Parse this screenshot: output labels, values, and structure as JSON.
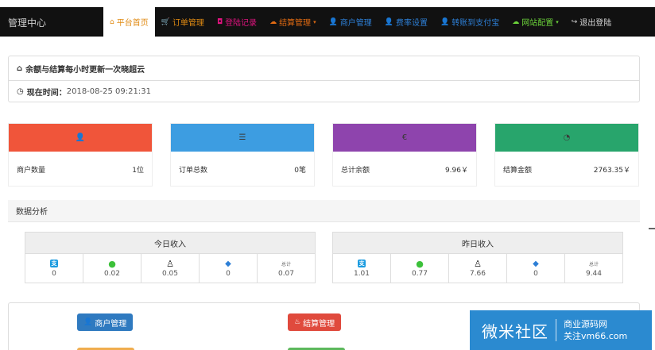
{
  "header": {
    "brand": "管理中心",
    "nav": [
      {
        "label": "平台首页",
        "icon": "⌂",
        "color": "#e08a12",
        "active": true
      },
      {
        "label": "订单管理",
        "icon": "🛒",
        "color": "#e08a12"
      },
      {
        "label": "登陆记录",
        "icon": "◘",
        "color": "#e0137f"
      },
      {
        "label": "结算管理",
        "icon": "☁",
        "color": "#e06a12",
        "caret": "▾"
      },
      {
        "label": "商户管理",
        "icon": "👤",
        "color": "#2d7fd6"
      },
      {
        "label": "费率设置",
        "icon": "👤",
        "color": "#2d7fd6"
      },
      {
        "label": "转账到支付宝",
        "icon": "👤",
        "color": "#2d7fd6"
      },
      {
        "label": "网站配置",
        "icon": "☁",
        "color": "#6cd43a",
        "caret": "▾"
      },
      {
        "label": "退出登陆",
        "icon": "↪",
        "color": "#d8d8d8"
      }
    ]
  },
  "notice": {
    "message": "余额与结算每小时更新一次晓超云",
    "time_label": "现在时间：",
    "time_value": "2018-08-25 09:21:31"
  },
  "cards": [
    {
      "icon": "👤",
      "color": "#f0553a",
      "label": "商户数量",
      "value": "1位"
    },
    {
      "icon": "☰",
      "color": "#3d9de1",
      "label": "订单总数",
      "value": "0笔"
    },
    {
      "icon": "€",
      "color": "#8e44ad",
      "label": "总计余额",
      "value": "9.96￥"
    },
    {
      "icon": "◔",
      "color": "#28a56c",
      "label": "结算金额",
      "value": "2763.35￥"
    }
  ],
  "section_title": "数据分析",
  "income": [
    {
      "title": "今日收入",
      "values": [
        "0",
        "0.02",
        "0.05",
        "0",
        "0.07"
      ]
    },
    {
      "title": "昨日收入",
      "values": [
        "1.01",
        "0.77",
        "7.66",
        "0",
        "9.44"
      ]
    }
  ],
  "payment_icons": [
    {
      "name": "alipay-icon",
      "glyph": "支",
      "color": "#1a9be0"
    },
    {
      "name": "wechat-icon",
      "glyph": "●",
      "color": "#3cc13a"
    },
    {
      "name": "qq-icon",
      "glyph": "♙",
      "color": "#222222"
    },
    {
      "name": "tenpay-icon",
      "glyph": "◆",
      "color": "#2d7fd6"
    },
    {
      "name": "total-icon",
      "text": "总计"
    }
  ],
  "bottom_buttons": [
    {
      "label": "商户管理",
      "icon": "👤",
      "color": "#2f7ac0"
    },
    {
      "label": "结算管理",
      "icon": "♨",
      "color": "#e04a3d"
    }
  ],
  "watermark": {
    "main": "微米社区",
    "line1": "商业源码网",
    "line2": "关注vm66.com"
  }
}
